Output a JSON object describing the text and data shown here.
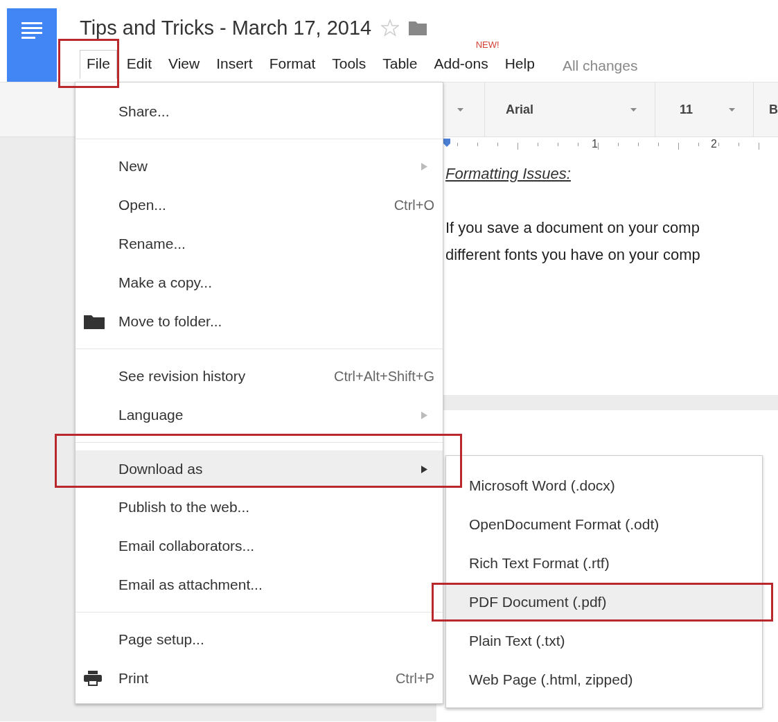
{
  "document_title": "Tips and Tricks - March 17, 2014",
  "starred": false,
  "menubar": [
    {
      "label": "File",
      "selected": true,
      "outlined": true
    },
    {
      "label": "Edit",
      "selected": false
    },
    {
      "label": "View",
      "selected": false
    },
    {
      "label": "Insert",
      "selected": false
    },
    {
      "label": "Format",
      "selected": false
    },
    {
      "label": "Tools",
      "selected": false
    },
    {
      "label": "Table",
      "selected": false
    },
    {
      "label": "Add-ons",
      "selected": false,
      "badge": "NEW!"
    },
    {
      "label": "Help",
      "selected": false
    }
  ],
  "save_status": "All changes",
  "toolbar": {
    "font": "Arial",
    "size": "11",
    "bold": "B"
  },
  "ruler": [
    "1",
    "2"
  ],
  "document": {
    "heading": "Formatting Issues:",
    "lines": [
      "If you save a document on your comp",
      "different fonts you have on your comp"
    ]
  },
  "file_menu": [
    {
      "kind": "item",
      "label": "Share..."
    },
    {
      "kind": "separator"
    },
    {
      "kind": "item",
      "label": "New",
      "submenu": true
    },
    {
      "kind": "item",
      "label": "Open...",
      "shortcut": "Ctrl+O"
    },
    {
      "kind": "item",
      "label": "Rename..."
    },
    {
      "kind": "item",
      "label": "Make a copy..."
    },
    {
      "kind": "folder",
      "label": "Move to folder..."
    },
    {
      "kind": "separator"
    },
    {
      "kind": "item",
      "label": "See revision history",
      "shortcut": "Ctrl+Alt+Shift+G"
    },
    {
      "kind": "item",
      "label": "Language",
      "submenu": true
    },
    {
      "kind": "separator"
    },
    {
      "kind": "item",
      "label": "Download as",
      "submenu": true,
      "selected": true,
      "outlined": true
    },
    {
      "kind": "item",
      "label": "Publish to the web..."
    },
    {
      "kind": "item",
      "label": "Email collaborators..."
    },
    {
      "kind": "item",
      "label": "Email as attachment..."
    },
    {
      "kind": "separator"
    },
    {
      "kind": "item",
      "label": "Page setup..."
    },
    {
      "kind": "printer",
      "label": "Print",
      "shortcut": "Ctrl+P"
    }
  ],
  "download_submenu": [
    {
      "label": "Microsoft Word (.docx)",
      "selected": false
    },
    {
      "label": "OpenDocument Format (.odt)",
      "selected": false
    },
    {
      "label": "Rich Text Format (.rtf)",
      "selected": false
    },
    {
      "label": "PDF Document (.pdf)",
      "selected": true,
      "outlined": true
    },
    {
      "label": "Plain Text (.txt)",
      "selected": false
    },
    {
      "label": "Web Page (.html, zipped)",
      "selected": false
    }
  ]
}
